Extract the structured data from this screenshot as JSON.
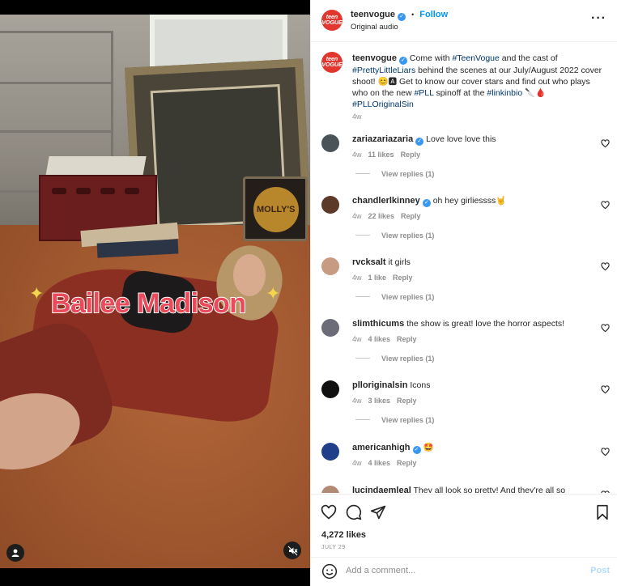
{
  "media": {
    "overlay_text": "Bailee Madison",
    "sign_text": "MOLLY'S"
  },
  "header": {
    "username": "teenvogue",
    "follow_label": "Follow",
    "separator": "•",
    "audio": "Original audio",
    "more_icon": "more-horizontal-icon",
    "avatar_text": "teen VOGUE"
  },
  "caption": {
    "username": "teenvogue",
    "parts": [
      {
        "text": " Come with ",
        "tag": false
      },
      {
        "text": "#TeenVogue",
        "tag": true
      },
      {
        "text": " and the cast of ",
        "tag": false
      },
      {
        "text": "#PrettyLittleLiars",
        "tag": true
      },
      {
        "text": " behind the scenes at our July/August 2022 cover shoot! 😊🅰 Get to know our cover stars and find out who plays who on the new ",
        "tag": false
      },
      {
        "text": "#PLL",
        "tag": true
      },
      {
        "text": " spinoff at the ",
        "tag": false
      },
      {
        "text": "#linkinbio",
        "tag": true
      },
      {
        "text": " 🔪🩸 ",
        "tag": false
      },
      {
        "text": "#PLLOriginalSin",
        "tag": true
      }
    ],
    "time": "4w"
  },
  "comments": [
    {
      "username": "zariazariazaria",
      "verified": true,
      "text": "Love love love this",
      "time": "4w",
      "likes": "11 likes",
      "reply": "Reply",
      "replies": "View replies (1)",
      "avatar_color": "#4a5358"
    },
    {
      "username": "chandlerlkinney",
      "verified": true,
      "text": "oh hey girliessss🤘",
      "time": "4w",
      "likes": "22 likes",
      "reply": "Reply",
      "replies": "View replies (1)",
      "avatar_color": "#5b3a2a"
    },
    {
      "username": "rvcksalt",
      "verified": false,
      "text": "it girls",
      "time": "4w",
      "likes": "1 like",
      "reply": "Reply",
      "replies": "View replies (1)",
      "avatar_color": "#c79a82"
    },
    {
      "username": "slimthicums",
      "verified": false,
      "text": "the show is great! love the horror aspects!",
      "time": "4w",
      "likes": "4 likes",
      "reply": "Reply",
      "replies": "View replies (1)",
      "avatar_color": "#6c6b78"
    },
    {
      "username": "plloriginalsin",
      "verified": false,
      "text": "Icons",
      "time": "4w",
      "likes": "3 likes",
      "reply": "Reply",
      "replies": "View replies (1)",
      "avatar_color": "#111111"
    },
    {
      "username": "americanhigh",
      "verified": true,
      "text": "🤩",
      "time": "4w",
      "likes": "4 likes",
      "reply": "Reply",
      "replies": "",
      "avatar_color": "#1f3f8a"
    },
    {
      "username": "lucindaemleal",
      "verified": false,
      "text": "They all look so pretty! And they're all so",
      "time": "",
      "likes": "",
      "reply": "",
      "replies": "",
      "avatar_color": "#b08a74"
    }
  ],
  "actions": {
    "icons": [
      "heart-icon",
      "comment-icon",
      "share-icon",
      "bookmark-icon"
    ],
    "likes": "4,272 likes",
    "date": "JULY 29"
  },
  "add_comment": {
    "placeholder": "Add a comment...",
    "post_label": "Post",
    "emoji_icon": "emoji-icon"
  }
}
